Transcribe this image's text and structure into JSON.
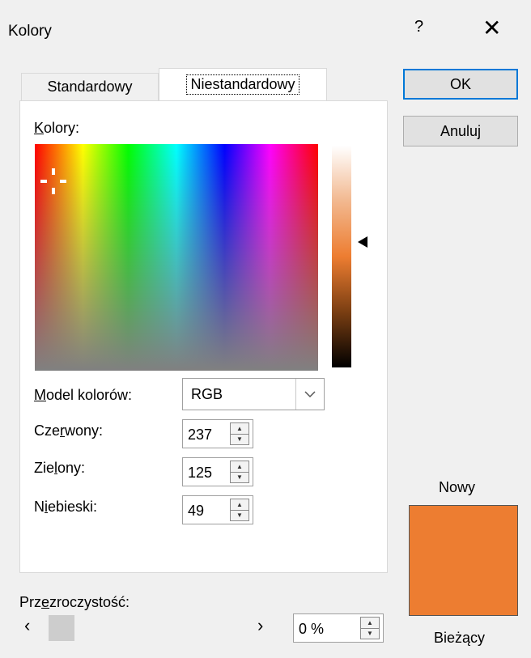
{
  "window": {
    "title": "Kolory",
    "help": "?",
    "close": "✕"
  },
  "tabs": {
    "standard": "Standardowy",
    "custom": "Niestandardowy"
  },
  "colors_label": {
    "prefix": "",
    "underlined": "K",
    "rest": "olory:"
  },
  "color_model": {
    "label_underlined": "M",
    "label_rest": "odel kolorów:",
    "value": "RGB"
  },
  "red": {
    "label_pre": "Cze",
    "label_u": "r",
    "label_post": "wony:",
    "value": "237"
  },
  "green": {
    "label_pre": "Zie",
    "label_u": "l",
    "label_post": "ony:",
    "value": "125"
  },
  "blue": {
    "label_pre": "N",
    "label_u": "i",
    "label_post": "ebieski:",
    "value": "49"
  },
  "transparency": {
    "label_pre": "Prz",
    "label_u": "e",
    "label_post": "zroczystość:",
    "value": "0 %"
  },
  "buttons": {
    "ok": "OK",
    "cancel": "Anuluj"
  },
  "preview": {
    "new_label": "Nowy",
    "current_label": "Bieżący",
    "color": "#ed7d31"
  },
  "icons": {
    "chevron": "chevron-down-icon",
    "left": "‹",
    "right": "›"
  }
}
